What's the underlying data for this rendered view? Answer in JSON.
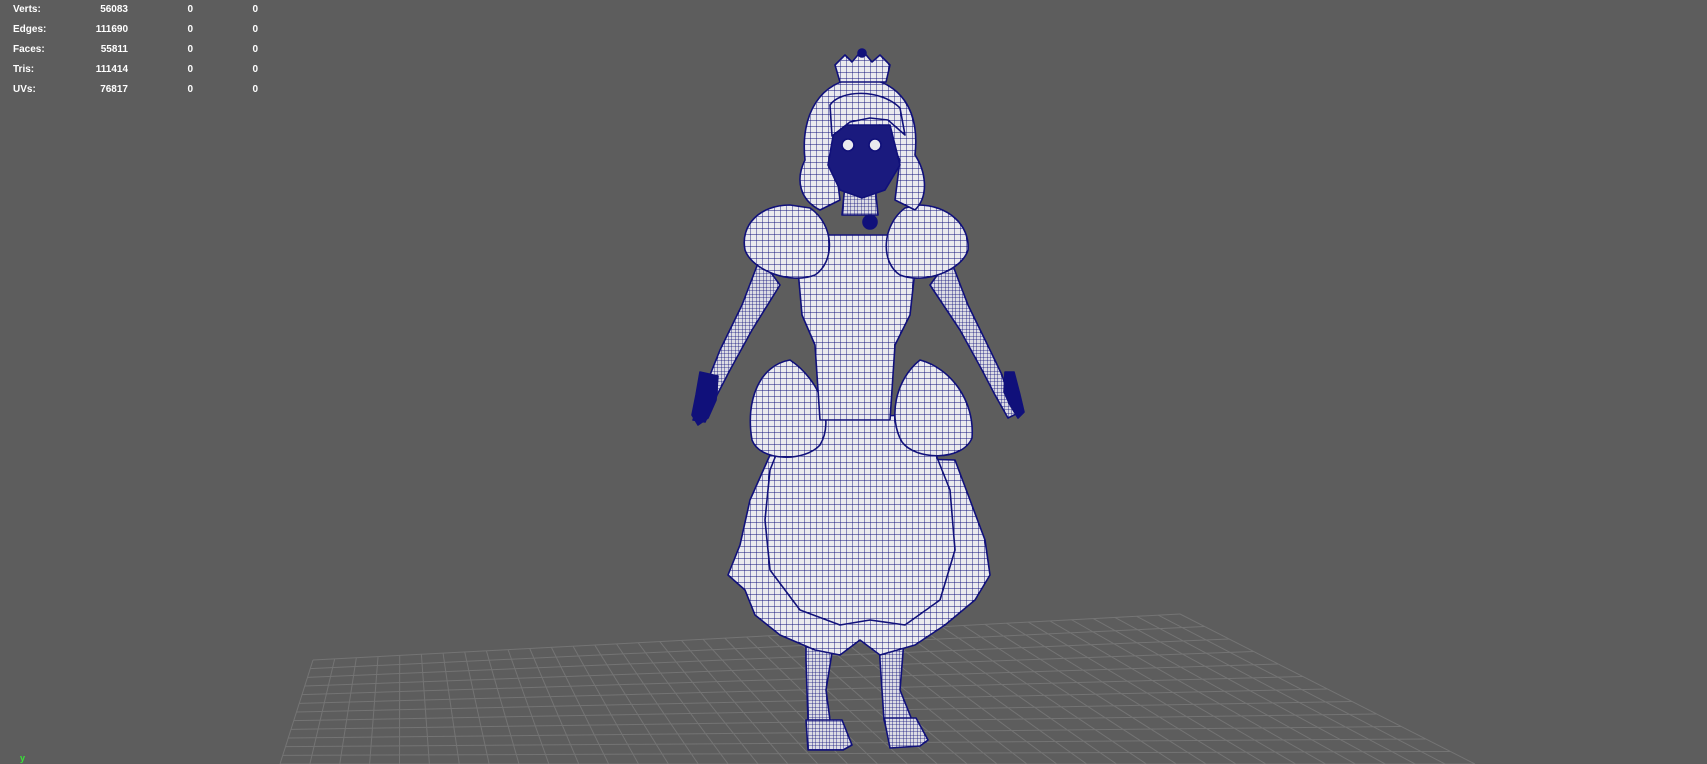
{
  "hud": {
    "rows": [
      {
        "label": "Verts:",
        "values": [
          "56083",
          "0",
          "0"
        ]
      },
      {
        "label": "Edges:",
        "values": [
          "111690",
          "0",
          "0"
        ]
      },
      {
        "label": "Faces:",
        "values": [
          "55811",
          "0",
          "0"
        ]
      },
      {
        "label": "Tris:",
        "values": [
          "111414",
          "0",
          "0"
        ]
      },
      {
        "label": "UVs:",
        "values": [
          "76817",
          "0",
          "0"
        ]
      }
    ]
  },
  "axis_indicator": {
    "label": "y",
    "color": "#36e836"
  },
  "colors": {
    "background": "#5d5d5d",
    "grid": "#747474",
    "wireframe": "#10107a",
    "surface": "#eaeaee",
    "hud_text": "#ffffff"
  },
  "scene": {
    "object": "wireframe-character-model",
    "display_mode": "wireframe-on-shaded"
  }
}
